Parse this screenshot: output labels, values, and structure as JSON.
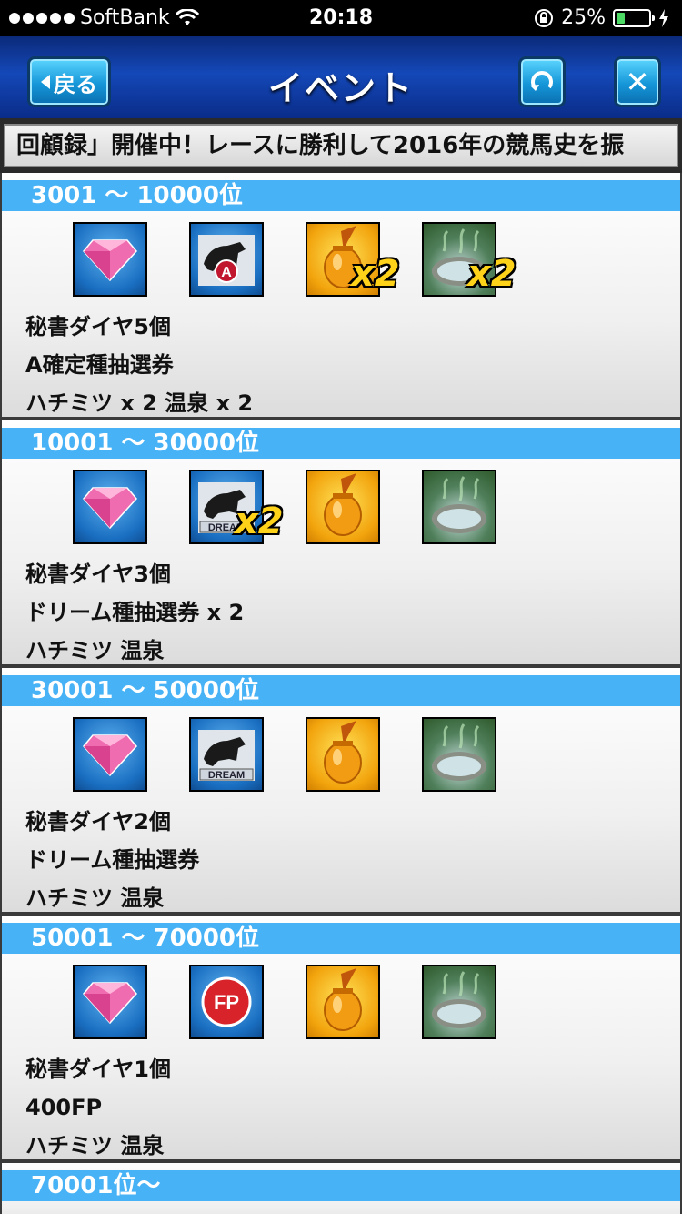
{
  "status": {
    "carrier": "SoftBank",
    "time": "20:18",
    "battery": "25%",
    "battery_level": 0.25
  },
  "header": {
    "title": "イベント",
    "back_label": "戻る",
    "close_label": "✕"
  },
  "ticker": {
    "text": "回顧録」開催中！レースに勝利して2016年の競馬史を振"
  },
  "tiers": [
    {
      "range": "3001 〜 10000位",
      "icons": [
        {
          "name": "diamond-icon",
          "mult": ""
        },
        {
          "name": "a-stud-ticket-icon",
          "mult": ""
        },
        {
          "name": "honey-icon",
          "mult": "x2"
        },
        {
          "name": "hot-spring-icon",
          "mult": "x2"
        }
      ],
      "lines": [
        "秘書ダイヤ5個",
        "A確定種抽選券",
        "ハチミツ x 2 温泉 x 2"
      ]
    },
    {
      "range": "10001 〜 30000位",
      "icons": [
        {
          "name": "diamond-icon",
          "mult": ""
        },
        {
          "name": "dream-stud-ticket-icon",
          "mult": "x2"
        },
        {
          "name": "honey-icon",
          "mult": ""
        },
        {
          "name": "hot-spring-icon",
          "mult": ""
        }
      ],
      "lines": [
        "秘書ダイヤ3個",
        "ドリーム種抽選券 x 2",
        "ハチミツ 温泉"
      ]
    },
    {
      "range": "30001 〜 50000位",
      "icons": [
        {
          "name": "diamond-icon",
          "mult": ""
        },
        {
          "name": "dream-stud-ticket-icon",
          "mult": ""
        },
        {
          "name": "honey-icon",
          "mult": ""
        },
        {
          "name": "hot-spring-icon",
          "mult": ""
        }
      ],
      "lines": [
        "秘書ダイヤ2個",
        "ドリーム種抽選券",
        "ハチミツ 温泉"
      ]
    },
    {
      "range": "50001 〜 70000位",
      "icons": [
        {
          "name": "diamond-icon",
          "mult": ""
        },
        {
          "name": "fp-icon",
          "mult": ""
        },
        {
          "name": "honey-icon",
          "mult": ""
        },
        {
          "name": "hot-spring-icon",
          "mult": ""
        }
      ],
      "lines": [
        "秘書ダイヤ1個",
        "400FP",
        "ハチミツ 温泉"
      ]
    },
    {
      "range": "70001位〜",
      "icons": [],
      "lines": []
    }
  ],
  "icon_text": {
    "a_badge": "A",
    "dream_badge": "DREAM",
    "fp_badge": "FP"
  }
}
